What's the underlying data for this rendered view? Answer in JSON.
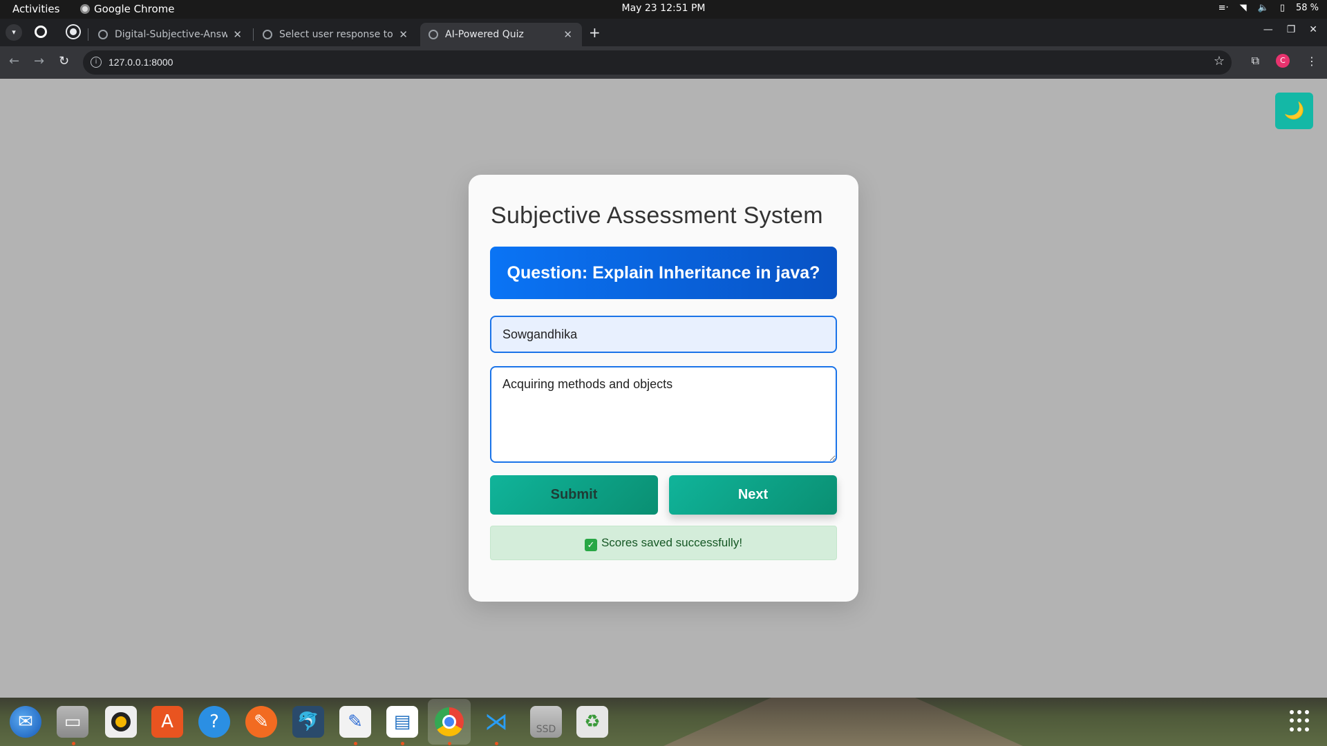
{
  "system_bar": {
    "activities": "Activities",
    "app_name": "Google Chrome",
    "clock": "May 23  12:51 PM",
    "battery": "58 %"
  },
  "browser": {
    "tabs": [
      {
        "title": "Digital-Subjective-Answe",
        "active": false
      },
      {
        "title": "Select user response to",
        "active": false
      },
      {
        "title": "AI-Powered Quiz",
        "active": true
      }
    ],
    "url": "127.0.0.1:8000",
    "profile_initial": "C"
  },
  "app": {
    "title": "Subjective Assessment System",
    "question": "Question: Explain Inheritance in java?",
    "name_value": "Sowgandhika",
    "answer_value": "Acquiring methods and objects",
    "submit_label": "Submit",
    "next_label": "Next",
    "status_message": "Scores saved successfully!",
    "theme_toggle_icon": "🌙"
  },
  "dock": {
    "items": [
      "thunderbird-icon",
      "files-icon",
      "rhythmbox-icon",
      "app-center-icon",
      "help-icon",
      "pen-tool-icon",
      "mysql-workbench-icon",
      "text-editor-icon",
      "libreoffice-writer-icon",
      "chrome-icon",
      "vscode-icon",
      "ssd-drive-icon",
      "trash-icon"
    ],
    "ssd_label": "SSD"
  },
  "colors": {
    "accent_blue": "#0a74f5",
    "accent_teal": "#10b49a",
    "success_bg": "#d4edda",
    "success_text": "#155724"
  }
}
